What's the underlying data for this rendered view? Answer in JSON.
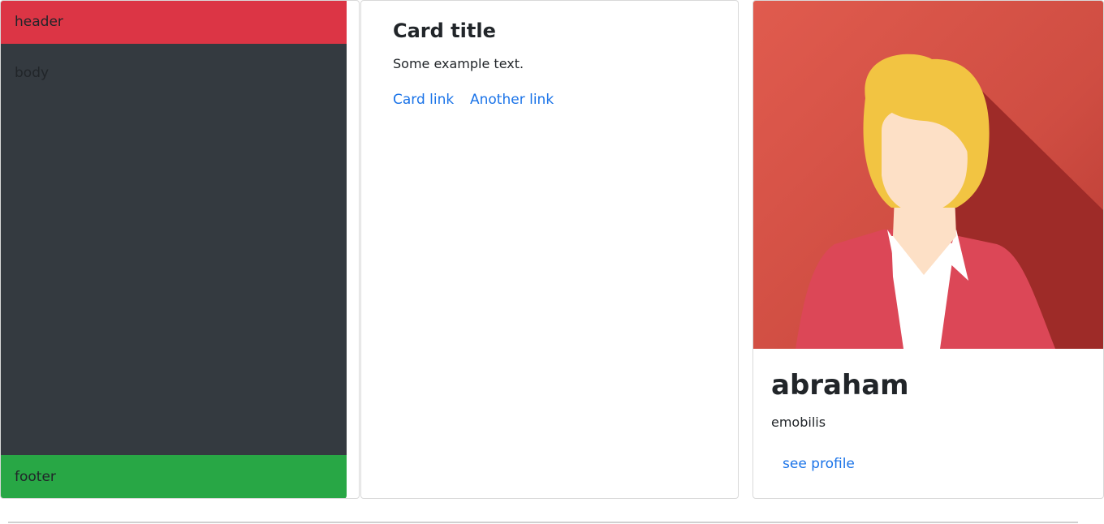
{
  "layout_card": {
    "header_label": "header",
    "body_label": "body",
    "footer_label": "footer",
    "colors": {
      "header": "#dc3545",
      "body": "#343a40",
      "footer": "#28a745"
    }
  },
  "text_card": {
    "title": "Card title",
    "text": "Some example text.",
    "links": [
      "Card link",
      "Another link"
    ]
  },
  "profile_card": {
    "avatar_icon": "woman-avatar-illustration",
    "name": "abraham",
    "text": "emobilis",
    "link": "see profile",
    "colors": {
      "background": "#d9534f",
      "hair": "#f2c442",
      "jacket": "#dc4757"
    }
  },
  "link_color": "#1a73e8"
}
